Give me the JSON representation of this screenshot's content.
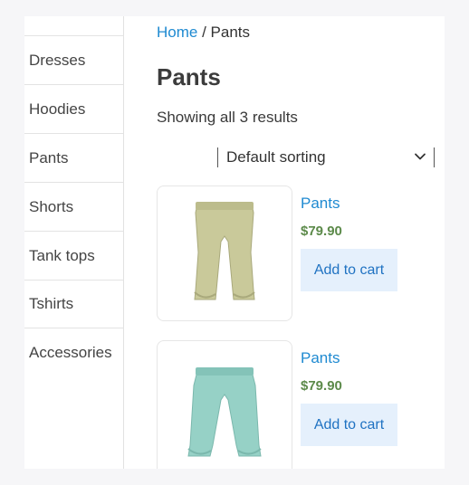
{
  "sidebar": {
    "items": [
      {
        "label": "Dresses"
      },
      {
        "label": "Hoodies"
      },
      {
        "label": "Pants"
      },
      {
        "label": "Shorts"
      },
      {
        "label": "Tank tops"
      },
      {
        "label": "Tshirts"
      },
      {
        "label": "Accessories"
      }
    ]
  },
  "breadcrumb": {
    "home": "Home",
    "separator": " / ",
    "current": "Pants"
  },
  "page": {
    "title": "Pants",
    "result_count": "Showing all 3 results"
  },
  "sorting": {
    "selected": "Default sorting",
    "icon": "chevron-down-icon"
  },
  "products": [
    {
      "name": "Pants",
      "price": "$79.90",
      "button": "Add to cart",
      "image_color": "#c9c99a"
    },
    {
      "name": "Pants",
      "price": "$79.90",
      "button": "Add to cart",
      "image_color": "#96d1c6"
    }
  ]
}
